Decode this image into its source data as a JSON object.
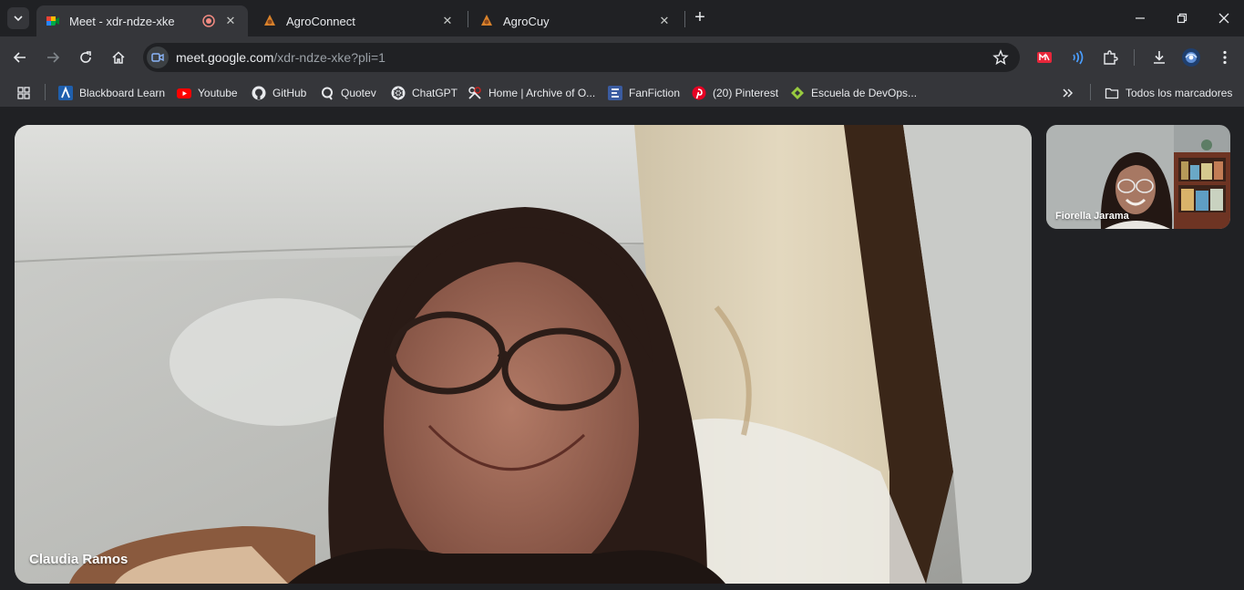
{
  "browser": {
    "tabs": [
      {
        "title": "Meet - xdr-ndze-xke",
        "active": true,
        "favicon": "google-meet-icon",
        "recording": true
      },
      {
        "title": "AgroConnect",
        "active": false,
        "favicon": "agro-logo-icon"
      },
      {
        "title": "AgroCuy",
        "active": false,
        "favicon": "agro-logo-icon"
      }
    ],
    "url": {
      "host": "meet.google.com",
      "path": "/xdr-ndze-xke?pli=1"
    },
    "bookmarks": [
      {
        "label": "Blackboard Learn",
        "icon": "blackboard-icon"
      },
      {
        "label": "Youtube",
        "icon": "youtube-icon"
      },
      {
        "label": "GitHub",
        "icon": "github-icon"
      },
      {
        "label": "Quotev",
        "icon": "quotev-icon"
      },
      {
        "label": "ChatGPT",
        "icon": "chatgpt-icon"
      },
      {
        "label": "Home | Archive of O...",
        "icon": "ao3-icon"
      },
      {
        "label": "FanFiction",
        "icon": "fanfiction-icon"
      },
      {
        "label": "(20) Pinterest",
        "icon": "pinterest-icon"
      },
      {
        "label": "Escuela de DevOps...",
        "icon": "devops-icon"
      }
    ],
    "all_bookmarks_label": "Todos los marcadores"
  },
  "meet": {
    "main_participant": {
      "name": "Claudia Ramos"
    },
    "side_participant": {
      "name": "Fiorella Jarama"
    }
  },
  "colors": {
    "chrome_dark": "#202124",
    "toolbar": "#35363a",
    "meet_accent": "#8ab4f8"
  }
}
